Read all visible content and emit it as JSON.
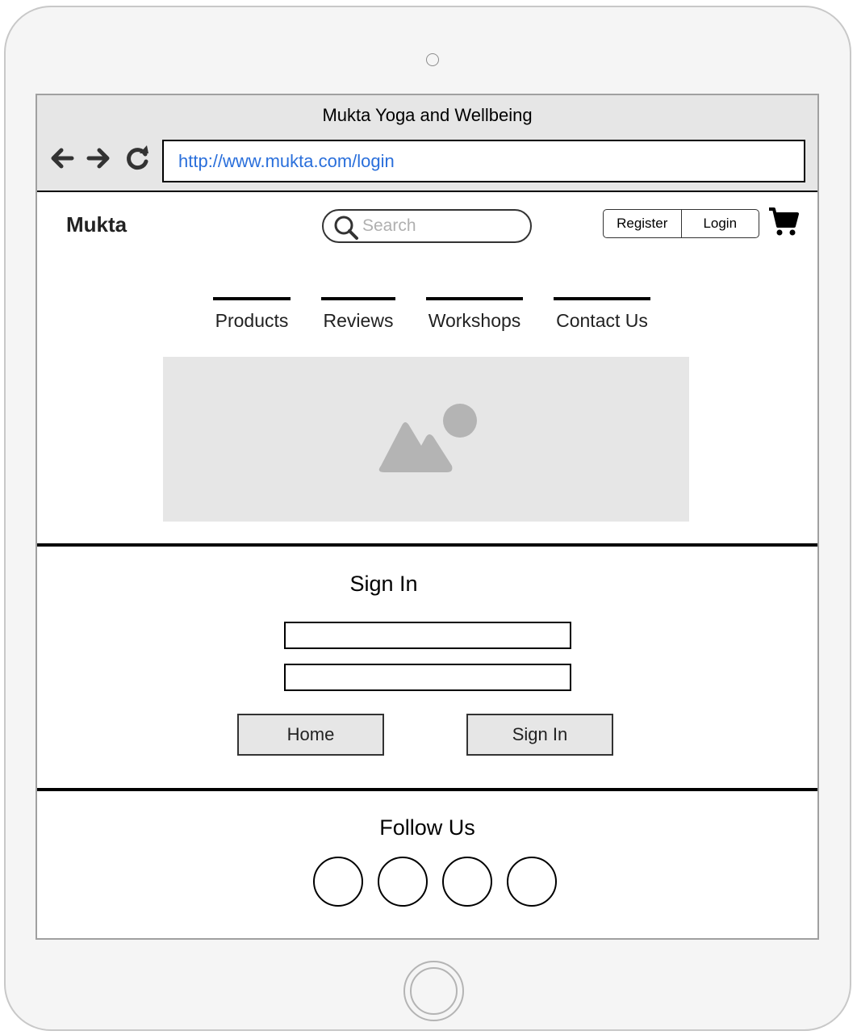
{
  "window": {
    "title": "Mukta Yoga and Wellbeing"
  },
  "browser": {
    "url": "http://www.mukta.com/login",
    "icons": [
      "back-arrow-icon",
      "forward-arrow-icon",
      "reload-icon"
    ]
  },
  "header": {
    "brand": "Mukta",
    "search_placeholder": "Search",
    "register_label": "Register",
    "login_label": "Login",
    "cart_icon": "shopping-cart-icon"
  },
  "nav": {
    "tabs": [
      {
        "label": "Products"
      },
      {
        "label": "Reviews"
      },
      {
        "label": "Workshops"
      },
      {
        "label": "Contact Us"
      }
    ]
  },
  "hero": {
    "icon": "image-placeholder-icon"
  },
  "signin": {
    "title": "Sign In",
    "username_value": "",
    "password_value": "",
    "home_label": "Home",
    "submit_label": "Sign In"
  },
  "footer": {
    "title": "Follow Us",
    "social_count": 4
  },
  "colors": {
    "url": "#2a6fdb",
    "chrome_bg": "#e6e6e6",
    "button_bg": "#e6e6e6",
    "placeholder": "#b0b0b0"
  }
}
